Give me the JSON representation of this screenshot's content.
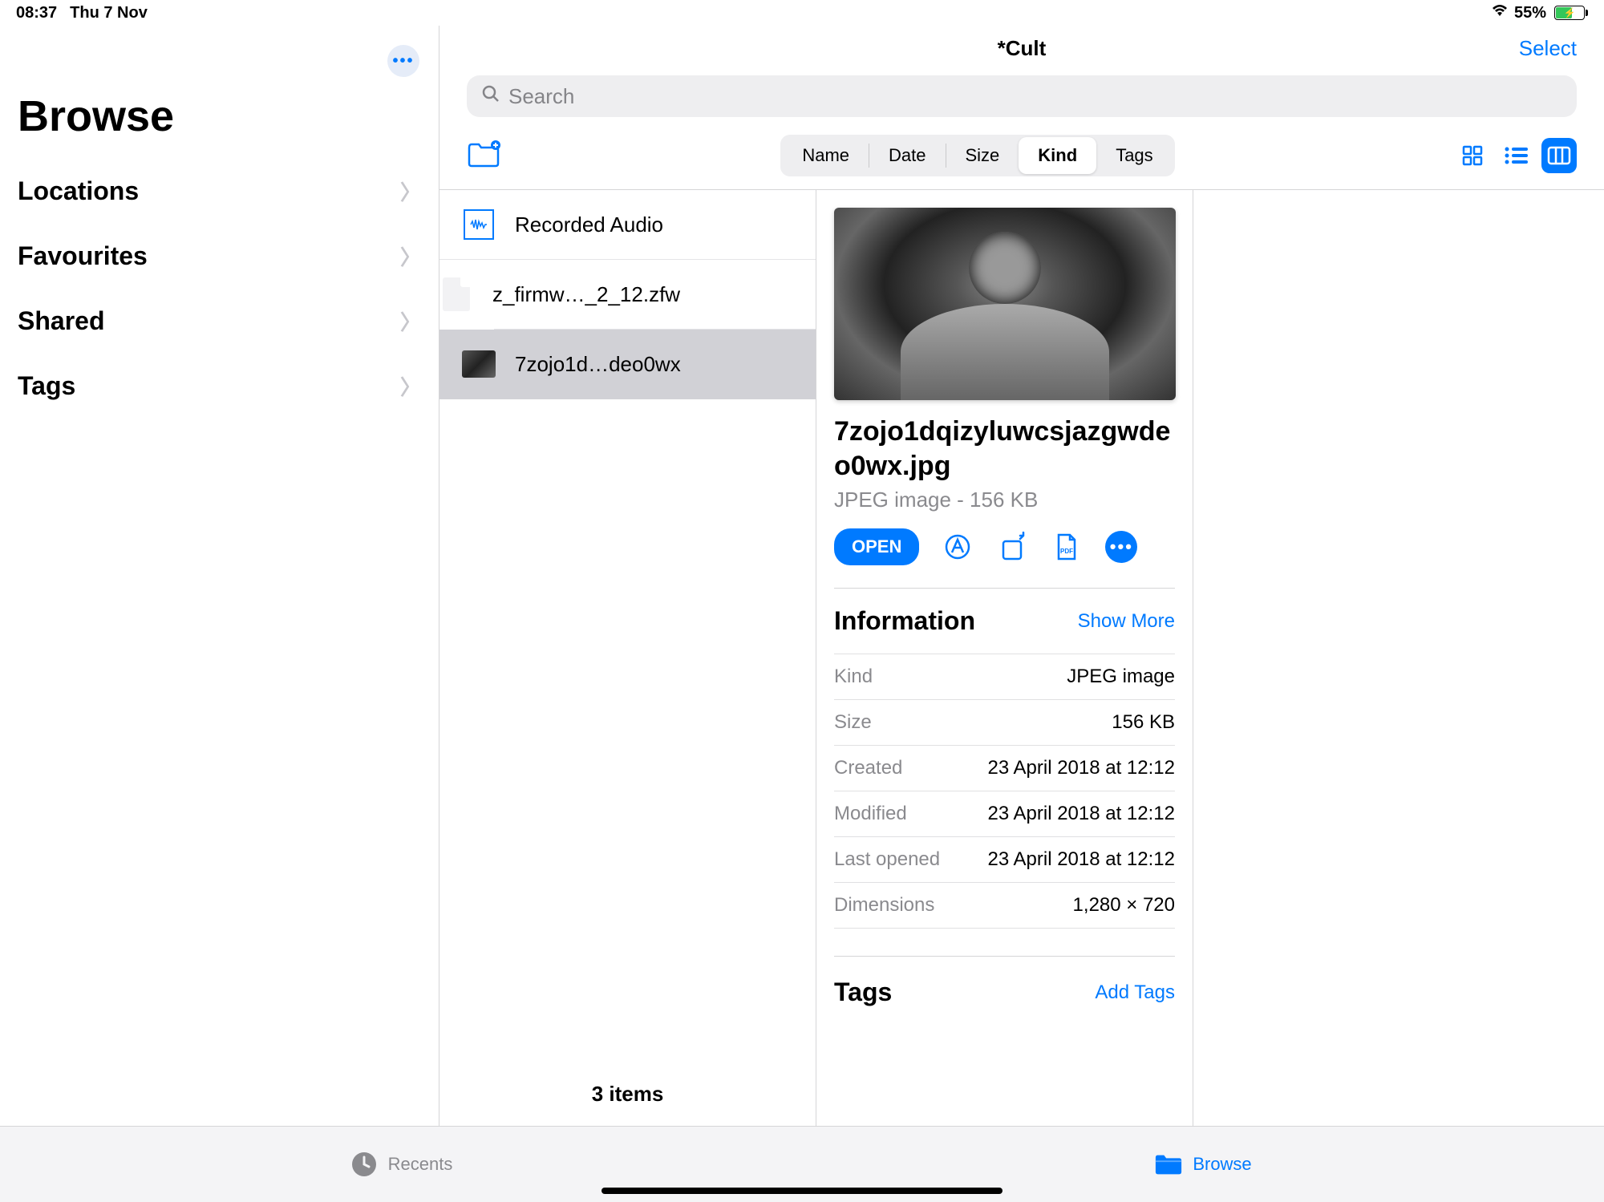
{
  "status": {
    "time": "08:37",
    "date": "Thu 7 Nov",
    "battery": "55%"
  },
  "sidebar": {
    "title": "Browse",
    "sections": [
      "Locations",
      "Favourites",
      "Shared",
      "Tags"
    ]
  },
  "header": {
    "folder": "*Cult",
    "select": "Select",
    "search_placeholder": "Search"
  },
  "sort": {
    "options": [
      "Name",
      "Date",
      "Size",
      "Kind",
      "Tags"
    ],
    "active": "Kind"
  },
  "files": {
    "items": [
      {
        "name": "Recorded Audio",
        "icon": "audio"
      },
      {
        "name": "z_firmw…_2_12.zfw",
        "icon": "doc"
      },
      {
        "name": "7zojo1d…deo0wx",
        "icon": "image",
        "selected": true
      }
    ],
    "count_label": "3 items"
  },
  "detail": {
    "filename": "7zojo1dqizyluwcsjazgwdeo0wx.jpg",
    "subtitle": "JPEG image - 156 KB",
    "open_label": "OPEN",
    "info_title": "Information",
    "show_more": "Show More",
    "rows": [
      {
        "k": "Kind",
        "v": "JPEG image"
      },
      {
        "k": "Size",
        "v": "156 KB"
      },
      {
        "k": "Created",
        "v": "23 April 2018 at 12:12"
      },
      {
        "k": "Modified",
        "v": "23 April 2018 at 12:12"
      },
      {
        "k": "Last opened",
        "v": "23 April 2018 at 12:12"
      },
      {
        "k": "Dimensions",
        "v": "1,280 × 720"
      }
    ],
    "tags_title": "Tags",
    "add_tags": "Add Tags"
  },
  "tabs": {
    "recents": "Recents",
    "browse": "Browse"
  }
}
